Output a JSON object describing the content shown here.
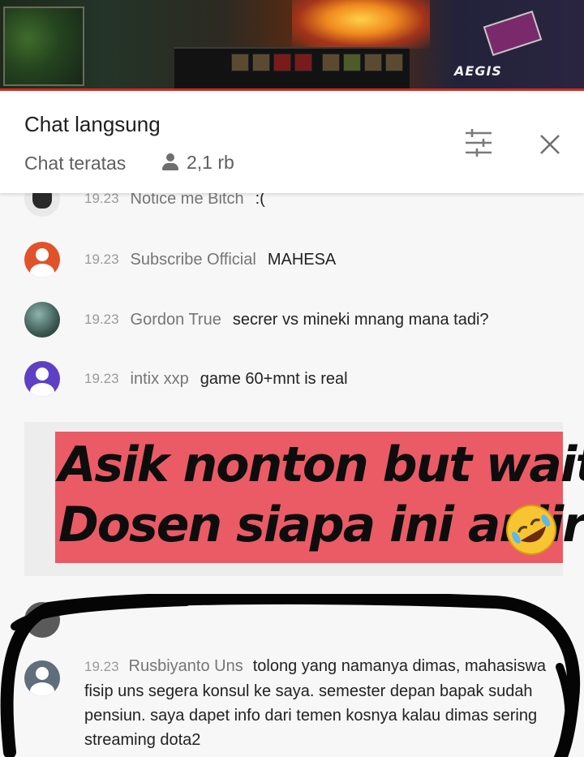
{
  "video": {
    "overlay_label": "AEGIS"
  },
  "header": {
    "title": "Chat langsung",
    "subtitle": "Chat teratas",
    "viewer_count": "2,1 rb",
    "icons": [
      "viewers-icon",
      "filter-icon",
      "close-icon"
    ]
  },
  "messages": [
    {
      "time": "19.23",
      "author": "Notice me Bitch",
      "text": ":(",
      "avatar_color": "#e9e9e9"
    },
    {
      "time": "19.23",
      "author": "Subscribe Official",
      "text": "MAHESA",
      "avatar_color": "#e0532a"
    },
    {
      "time": "19.23",
      "author": "Gordon True",
      "text": "secrer vs mineki mnang mana tadi?",
      "avatar_color": "#3c5a52"
    },
    {
      "time": "19.23",
      "author": "intix xxp",
      "text": "game 60+mnt is real",
      "avatar_color": "#5e40c4"
    }
  ],
  "overlay": {
    "line1": "Asik nonton but wait..",
    "line2": "Dosen siapa ini anjir",
    "emoji": "rolling-on-floor-laughing-emoji",
    "background": "#ea5b66"
  },
  "highlighted_message": {
    "time": "19.23",
    "author": "Rusbiyanto Uns",
    "text": "tolong yang namanya dimas, mahasiswa fisip uns segera konsul ke saya. semester depan bapak sudah pensiun. saya dapet info dari temen kosnya kalau dimas sering streaming dota2",
    "avatar_color": "#5f6e7a"
  }
}
